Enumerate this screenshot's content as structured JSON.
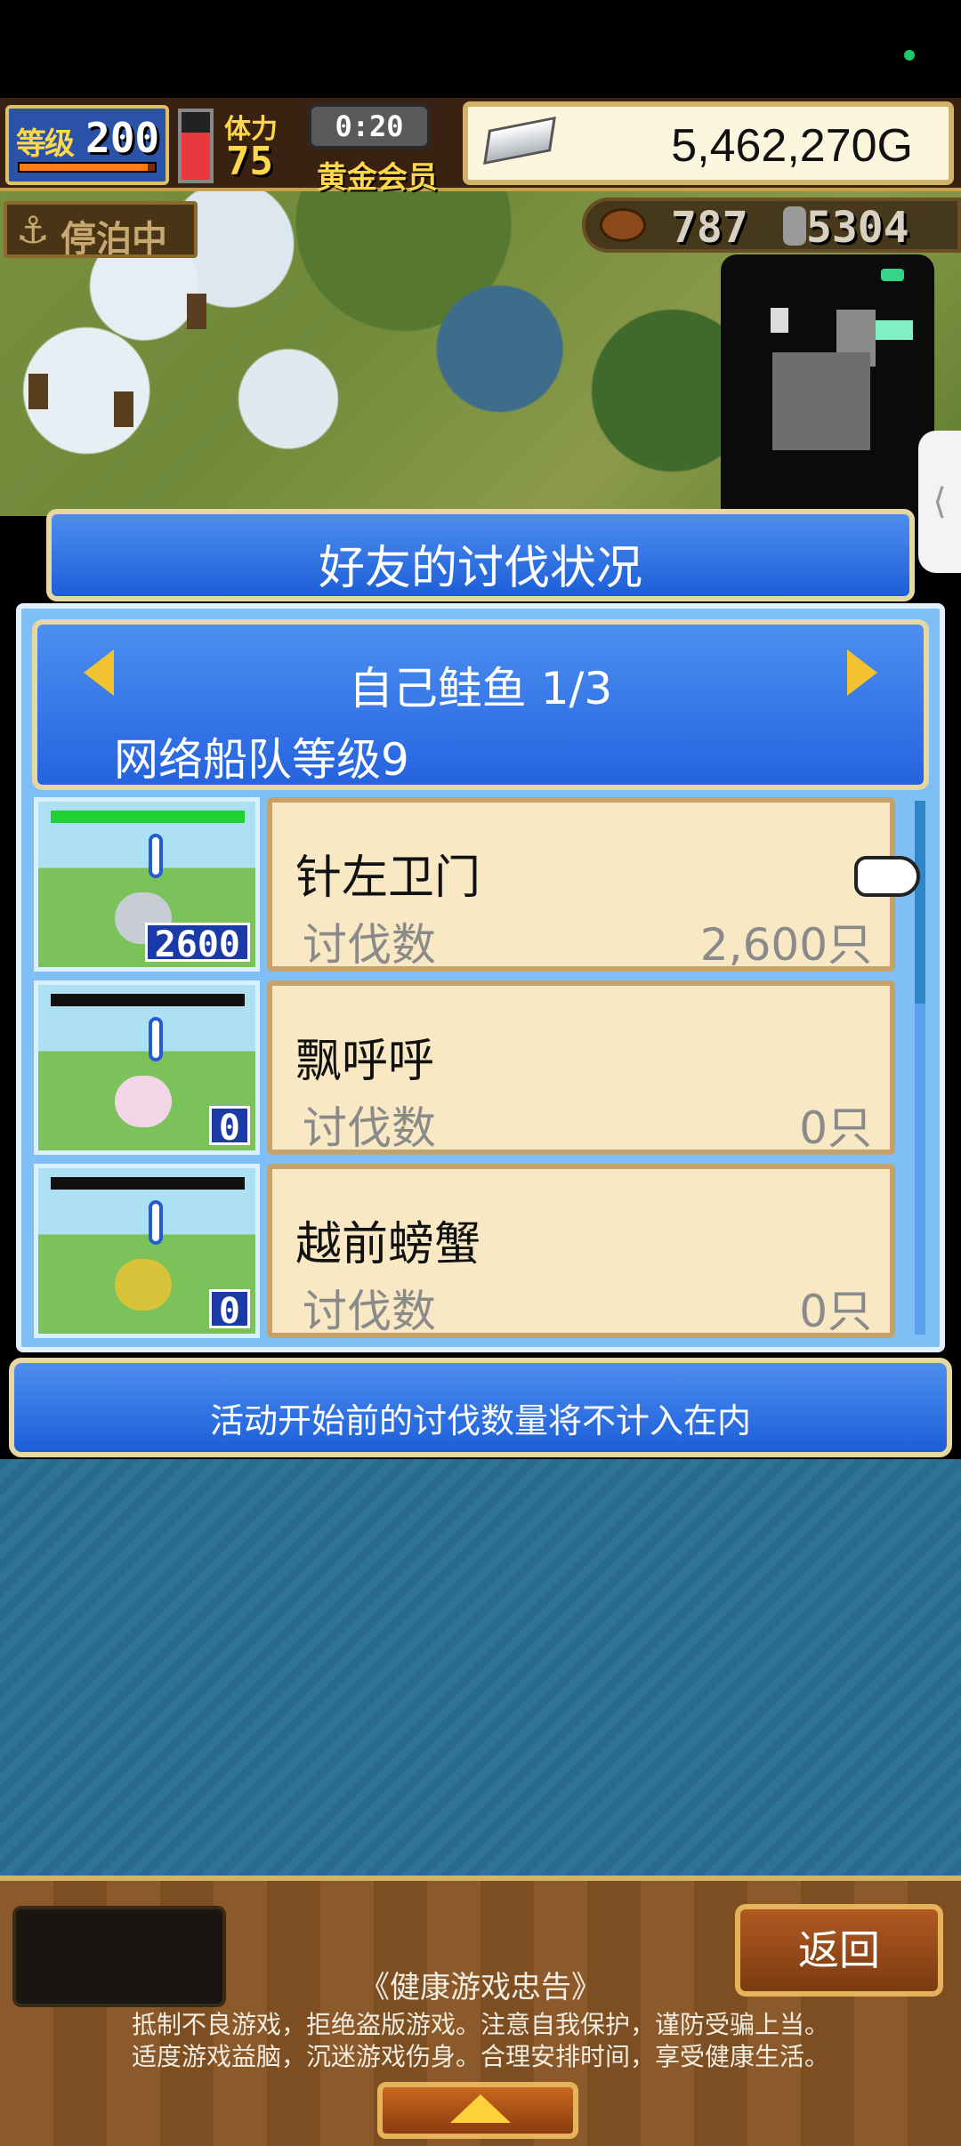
{
  "hud": {
    "level_label": "等级",
    "level": "200",
    "level_progress": 0.95,
    "stamina_label": "体力",
    "stamina": "75",
    "stamina_gauge_fill": 0.7,
    "timer": "0:20",
    "membership": "黄金会员",
    "gold": "5,462,270G",
    "anchor_status": "停泊中",
    "food": "787",
    "wood": "5304"
  },
  "dialog": {
    "title": "好友的讨伐状况",
    "category": "自己鲑鱼 1/3",
    "fleet_level": "网络船队等级9",
    "entries": [
      {
        "name": "针左卫门",
        "count_label": "讨伐数",
        "count": "2,600只",
        "thumb_count": "2600",
        "bar_fill": 1.0,
        "creature_color": "#c8ccd4"
      },
      {
        "name": "飘呼呼",
        "count_label": "讨伐数",
        "count": "0只",
        "thumb_count": "0",
        "bar_fill": 0.0,
        "creature_color": "#f2d6e6"
      },
      {
        "name": "越前螃蟹",
        "count_label": "讨伐数",
        "count": "0只",
        "thumb_count": "0",
        "bar_fill": 0.0,
        "creature_color": "#d8c23a"
      }
    ],
    "notice": "活动开始前的讨伐数量将不计入在内",
    "scroll_position": 0.0,
    "scroll_visible_fraction": 0.38
  },
  "bottom": {
    "back_label": "返回",
    "health_title": "《健康游戏忠告》",
    "health_line1": "抵制不良游戏，拒绝盗版游戏。注意自我保护，谨防受骗上当。",
    "health_line2": "适度游戏益脑，沉迷游戏伤身。合理安排时间，享受健康生活。"
  },
  "icons": {
    "anchor": "⚓",
    "side_handle": "⟨"
  },
  "colors": {
    "accent_blue": "#2563df",
    "gold_frame": "#e7d7a0",
    "card_bg": "#f8e8c4"
  }
}
